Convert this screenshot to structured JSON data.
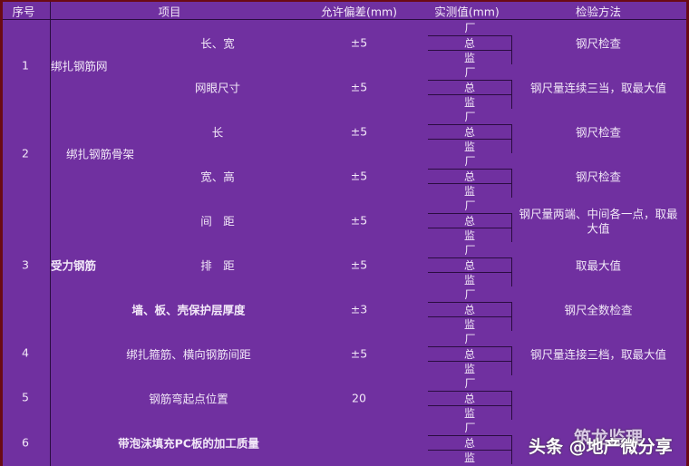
{
  "header": {
    "seq": "序号",
    "item": "项目",
    "tolerance": "允许偏差(mm)",
    "measured": "实测值(mm)",
    "method": "检验方法"
  },
  "measure_labels": [
    "厂",
    "总",
    "监"
  ],
  "groups": [
    {
      "seq": "1",
      "category": "绑扎钢筋网",
      "item": "长、宽",
      "tolerance": "±5",
      "method": "钢尺检查"
    },
    {
      "item": "网眼尺寸",
      "tolerance": "±5",
      "method": "钢尺量连续三当，取最大值"
    },
    {
      "seq": "2",
      "category": "绑扎钢筋骨架",
      "item": "长",
      "tolerance": "±5",
      "method": "钢尺检查"
    },
    {
      "item": "宽、高",
      "tolerance": "±5",
      "method": "钢尺检查"
    },
    {
      "item": "间　距",
      "tolerance": "±5",
      "method": "钢尺量两端、中间各一点，取最",
      "method2": "大值"
    },
    {
      "seq": "3",
      "category": "受力钢筋",
      "item": "排　距",
      "tolerance": "±5",
      "method": "取最大值"
    },
    {
      "item": "墙、板、壳保护层厚度",
      "bold": true,
      "tolerance": "±3",
      "method": "钢尺全数检查"
    },
    {
      "seq": "4",
      "item": "绑扎箍筋、横向钢筋间距",
      "tolerance": "±5",
      "method": "钢尺量连接三档，取最大值"
    },
    {
      "seq": "5",
      "item": "钢筋弯起点位置",
      "tolerance": "20"
    },
    {
      "seq": "6",
      "item": "带泡沫填充PC板的加工质量",
      "bold": true
    }
  ],
  "watermark": {
    "brand": "头条 @地产微分享",
    "overlay": "筑龙监理"
  }
}
